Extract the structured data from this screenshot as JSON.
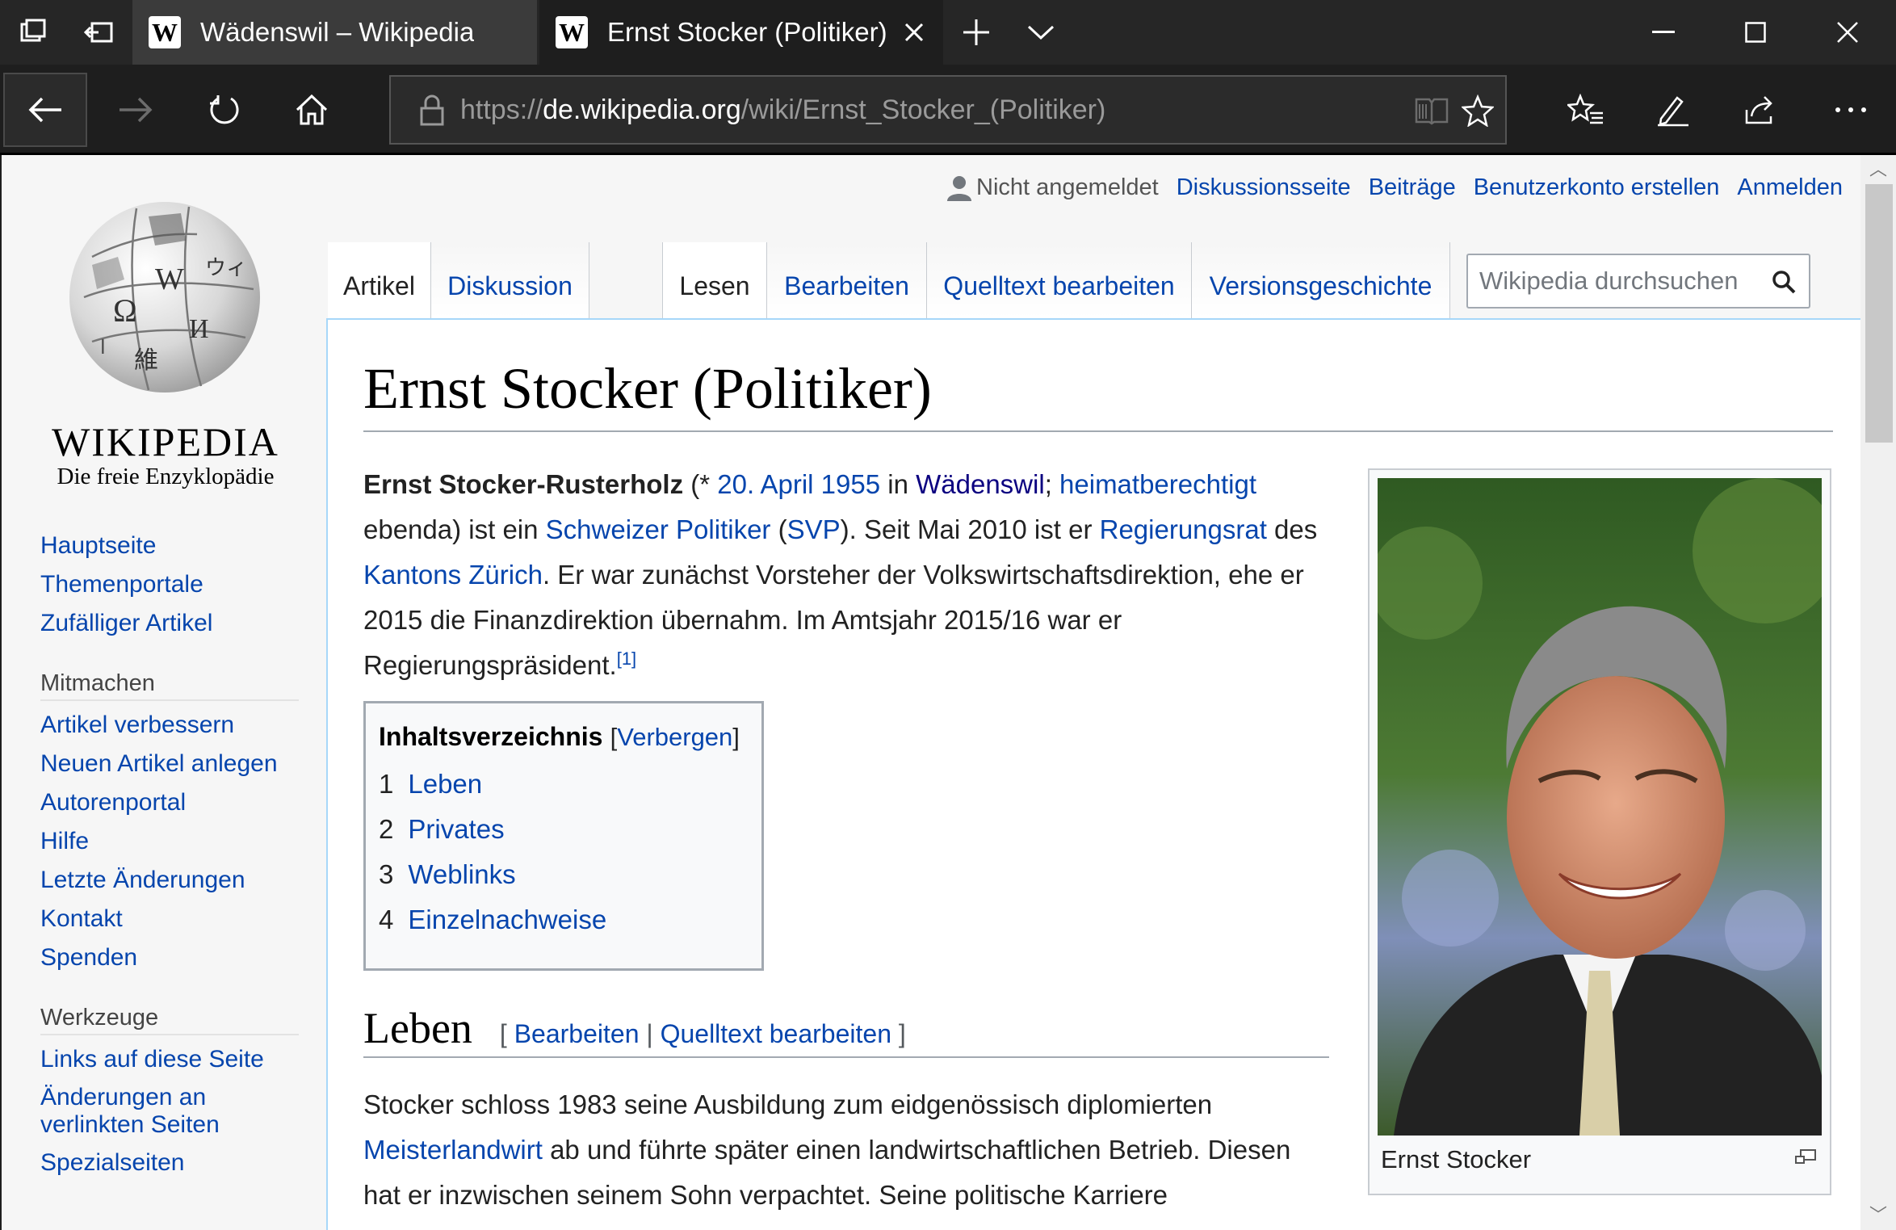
{
  "browser": {
    "tabs": [
      {
        "title": "Wädenswil – Wikipedia",
        "favicon": "W",
        "active": false
      },
      {
        "title": "Ernst Stocker (Politiker)",
        "favicon": "W",
        "active": true
      }
    ],
    "url_prefix": "https://",
    "url_host": "de.wikipedia.org",
    "url_path": "/wiki/Ernst_Stocker_(Politiker)"
  },
  "logo": {
    "wordmark": "WIKIPEDIA",
    "tagline": "Die freie Enzyklopädie"
  },
  "sidebar": {
    "main_links": [
      "Hauptseite",
      "Themenportale",
      "Zufälliger Artikel"
    ],
    "mitmachen_heading": "Mitmachen",
    "mitmachen_links": [
      "Artikel verbessern",
      "Neuen Artikel anlegen",
      "Autorenportal",
      "Hilfe",
      "Letzte Änderungen",
      "Kontakt",
      "Spenden"
    ],
    "werkzeuge_heading": "Werkzeuge",
    "werkzeuge_links": [
      "Links auf diese Seite",
      "Änderungen an verlinkten Seiten",
      "Spezialseiten"
    ]
  },
  "personal": {
    "not_logged_in": "Nicht angemeldet",
    "talk": "Diskussionsseite",
    "contributions": "Beiträge",
    "create_account": "Benutzerkonto erstellen",
    "login": "Anmelden"
  },
  "tabs": {
    "article": "Artikel",
    "discussion": "Diskussion",
    "read": "Lesen",
    "edit": "Bearbeiten",
    "edit_source": "Quelltext bearbeiten",
    "history": "Versionsgeschichte"
  },
  "search": {
    "placeholder": "Wikipedia durchsuchen"
  },
  "article": {
    "title": "Ernst Stocker (Politiker)",
    "intro": {
      "name": "Ernst Stocker-Rusterholz",
      "t1": " (* ",
      "birthdate": "20. April 1955",
      "t2": " in ",
      "birthplace": "Wädenswil",
      "t3": "; ",
      "heimat": "heimatberechtigt",
      "t4": " ebenda) ist ein ",
      "politician": "Schweizer Politiker",
      "t5": " (",
      "party": "SVP",
      "t6": "). Seit Mai 2010 ist er ",
      "regierungsrat": "Regierungsrat",
      "t7": " des ",
      "canton": "Kantons Zürich",
      "t8": ". Er war zunächst Vorsteher der Volkswirtschaftsdirektion, ehe er 2015 die Finanzdirektion übernahm. Im Amtsjahr 2015/16 war er Regierungspräsident.",
      "ref": "[1]"
    },
    "toc": {
      "title": "Inhaltsverzeichnis",
      "toggle": "Verbergen",
      "items": [
        {
          "num": "1",
          "label": "Leben"
        },
        {
          "num": "2",
          "label": "Privates"
        },
        {
          "num": "3",
          "label": "Weblinks"
        },
        {
          "num": "4",
          "label": "Einzelnachweise"
        }
      ]
    },
    "section": {
      "heading": "Leben",
      "edit": "Bearbeiten",
      "edit_source": "Quelltext bearbeiten",
      "p1": "Stocker schloss 1983 seine Ausbildung zum eidgenössisch diplomierten ",
      "link": "Meisterlandwirt",
      "p2": " ab und führte später einen landwirtschaftlichen Betrieb. Diesen hat er inzwischen seinem Sohn verpachtet. Seine politische Karriere"
    },
    "image_caption": "Ernst Stocker"
  },
  "colors": {
    "link": "#0645ad",
    "visited_link": "#0b0080",
    "chrome": "#262626"
  }
}
